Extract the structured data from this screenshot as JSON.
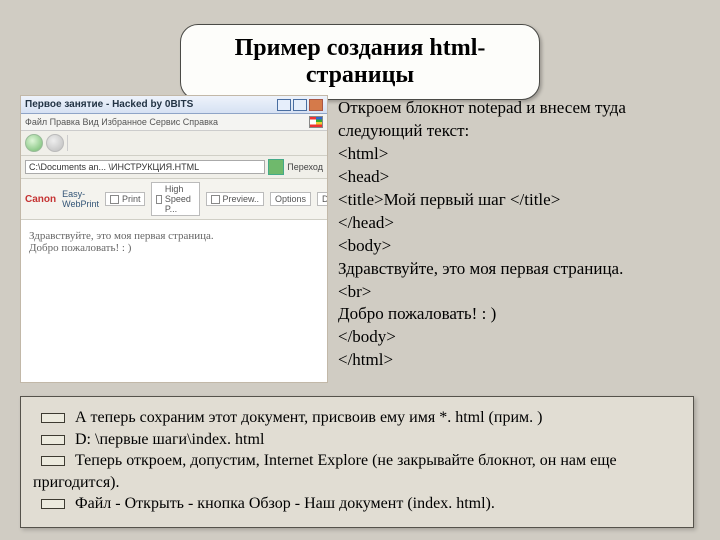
{
  "title": "Пример создания html-страницы",
  "screenshot": {
    "window_title": "Первое занятие - Hacked by 0BITS",
    "menu_text": "Файл  Правка  Вид  Избранное  Сервис  Справка",
    "address_value": "C:\\Documents an... \\ИНСТРУКЦИЯ.HTML",
    "go_label": "Переход",
    "canon_brand": "Canon",
    "canon_prod": "Easy-WebPrint",
    "canon_btns": [
      "Print",
      "High Speed P...",
      "Preview..",
      "Options",
      "Dupl..."
    ],
    "body_line1": "Здравствуйте, это моя первая страница.",
    "body_line2": "Добро пожаловать! : )"
  },
  "code": {
    "intro1": "Откроем блокнот notepad и внесем туда",
    "intro2": "следующий текст:",
    "l1": "<html>",
    "l2": "<head>",
    "l3": "<title>Мой первый шаг </title>",
    "l4": "</head>",
    "l5": "<body>",
    "l6": "Здравствуйте, это моя первая страница.",
    "l7": "<br>",
    "l8": "Добро пожаловать! : )",
    "l9": "</body>",
    "l10": "</html>"
  },
  "bottom": {
    "b1": "А теперь сохраним этот документ, присвоив ему имя *. html (прим. )",
    "b2": "D: \\первые шаги\\index. html",
    "b3": "Теперь откроем, допустим, Internet Explore (не закрывайте блокнот, он нам еще",
    "b3c": "пригодится).",
    "b4": "Файл - Открыть - кнопка Обзор - Наш документ (index. html)."
  }
}
